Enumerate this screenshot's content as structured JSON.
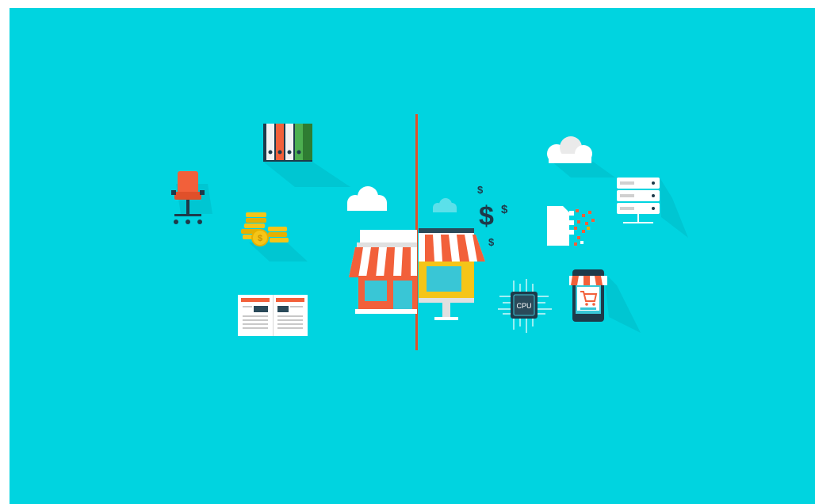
{
  "colors": {
    "background": "#00d4e0",
    "divider": "#e0502a",
    "accent_orange": "#f2603a",
    "accent_yellow": "#f5c518",
    "dark": "#1e3a4a",
    "white": "#ffffff",
    "shadow": "#00b8c4"
  },
  "icons": [
    "office-chair-icon",
    "binders-icon",
    "coin-stack-icon",
    "newspaper-icon",
    "cloud-icon",
    "shop-icon",
    "monitor-shop-icon",
    "dollar-signs-icon",
    "cloud-icon",
    "pixel-document-icon",
    "server-rack-icon",
    "cpu-chip-icon",
    "mobile-shop-icon"
  ],
  "texts": {
    "dollar_big": "$",
    "dollar_small": "$",
    "cpu_label": "CPU"
  }
}
